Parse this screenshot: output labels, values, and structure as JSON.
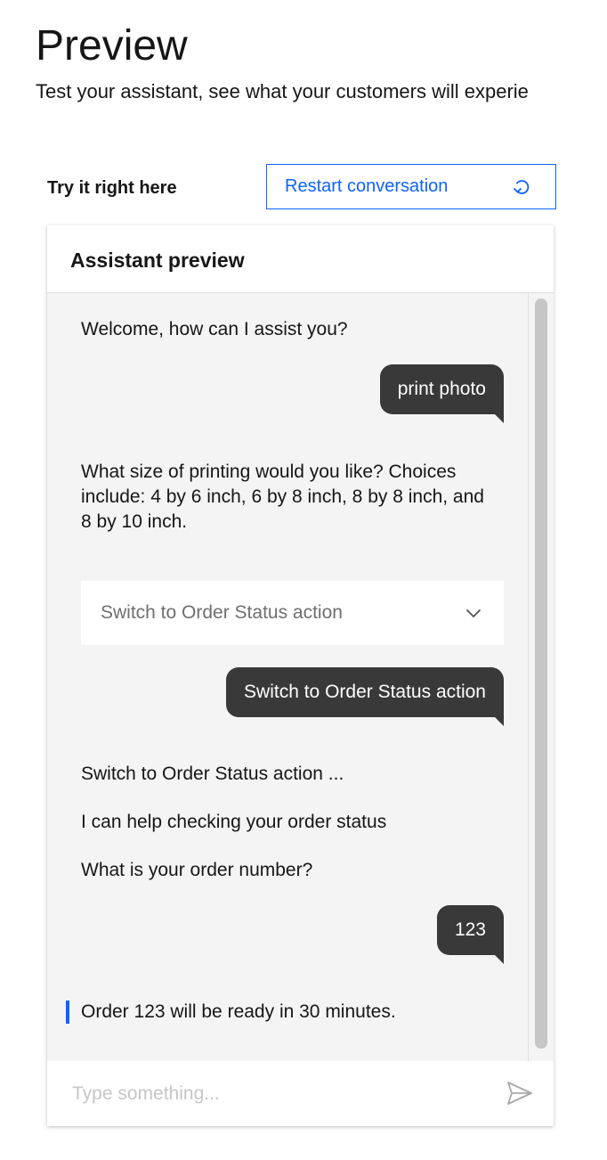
{
  "page": {
    "title": "Preview",
    "subtitle": "Test your assistant, see what your customers will experie"
  },
  "toolbar": {
    "try_label": "Try it right here",
    "restart_label": "Restart conversation",
    "restart_icon": "restart-icon"
  },
  "panel": {
    "title": "Assistant preview"
  },
  "chat": {
    "bot_welcome": "Welcome, how can I assist you?",
    "user_1": "print photo",
    "bot_size_question": "What size of printing would you like? Choices include: 4 by 6 inch, 6 by 8 inch, 8 by 8 inch, and 8 by 10 inch.",
    "dropdown_value": "Switch to Order Status action",
    "user_2": "Switch to Order Status action",
    "bot_switch": "Switch to Order Status action ...",
    "bot_help": "I can help checking your order status",
    "bot_order_question": "What is your order number?",
    "user_3": "123",
    "bot_ready": "Order 123 will be ready in 30 minutes."
  },
  "input": {
    "placeholder": "Type something...",
    "send_icon": "send-icon"
  },
  "colors": {
    "accent": "#0f62fe",
    "bubble": "#393939",
    "chat_background": "#f4f4f4",
    "placeholder": "#c6c6c6"
  }
}
